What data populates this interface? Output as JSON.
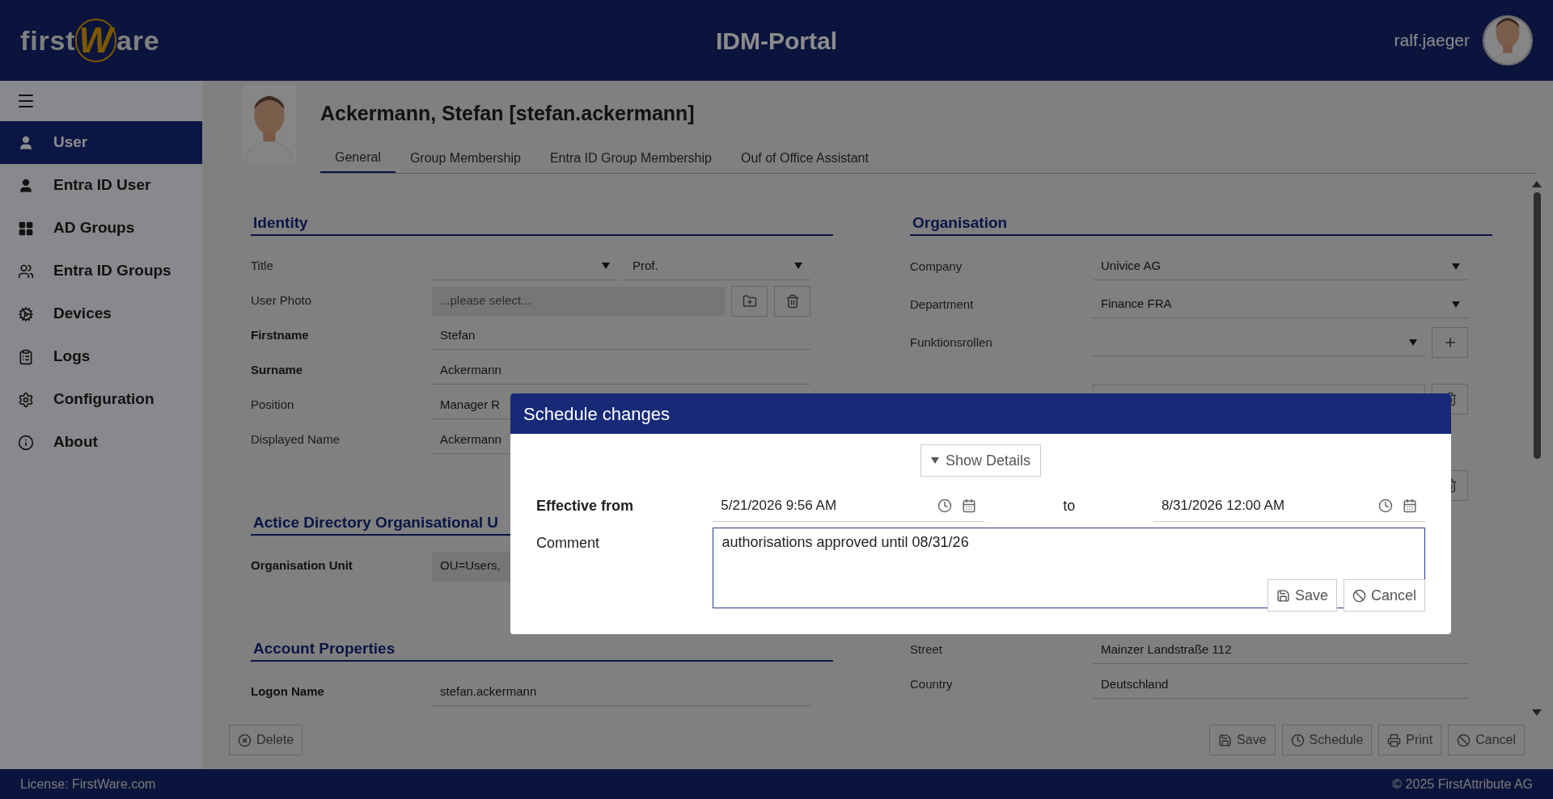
{
  "header": {
    "logo": {
      "left": "first",
      "mark": "W",
      "right": "are"
    },
    "title": "IDM-Portal",
    "username": "ralf.jaeger"
  },
  "sidebar": {
    "items": [
      {
        "label": "User",
        "kind": "user",
        "selected": true
      },
      {
        "label": "Entra ID User",
        "kind": "user",
        "selected": false
      },
      {
        "label": "AD Groups",
        "kind": "grid",
        "selected": false
      },
      {
        "label": "Entra ID Groups",
        "kind": "groups",
        "selected": false
      },
      {
        "label": "Devices",
        "kind": "cogs",
        "selected": false
      },
      {
        "label": "Logs",
        "kind": "clipboard",
        "selected": false
      },
      {
        "label": "Configuration",
        "kind": "gear",
        "selected": false
      },
      {
        "label": "About",
        "kind": "info",
        "selected": false
      }
    ]
  },
  "profile": {
    "heading": "Ackermann, Stefan [stefan.ackermann]"
  },
  "tabs": [
    {
      "label": "General",
      "selected": true
    },
    {
      "label": "Group Membership",
      "selected": false
    },
    {
      "label": "Entra ID Group Membership",
      "selected": false
    },
    {
      "label": "Ouf of Office Assistant",
      "selected": false
    }
  ],
  "left_sections": [
    {
      "title": "Identity",
      "rows": [
        {
          "label": "Title",
          "bold": false,
          "controls": [
            {
              "kind": "select"
            },
            {
              "kind": "select",
              "value": "Prof."
            }
          ]
        },
        {
          "label": "User Photo",
          "bold": false,
          "controls": [
            {
              "kind": "file",
              "placeholder": "...please select..."
            },
            {
              "kind": "browse"
            },
            {
              "kind": "delete"
            }
          ]
        },
        {
          "label": "Firstname",
          "bold": true,
          "controls": [
            {
              "kind": "text",
              "value": "Stefan"
            }
          ]
        },
        {
          "label": "Surname",
          "bold": true,
          "controls": [
            {
              "kind": "text",
              "value": "Ackermann"
            }
          ]
        },
        {
          "label": "Position",
          "bold": false,
          "controls": [
            {
              "kind": "text",
              "value": "Manager R"
            }
          ]
        },
        {
          "label": "Displayed Name",
          "bold": false,
          "controls": [
            {
              "kind": "text",
              "value": "Ackermann"
            }
          ]
        }
      ]
    },
    {
      "title": "Actice Directory Organisational U",
      "rows": [
        {
          "label": "Organisation Unit",
          "bold": true,
          "controls": [
            {
              "kind": "readonly",
              "value": "OU=Users,"
            }
          ]
        }
      ]
    },
    {
      "title": "Account Properties",
      "rows": [
        {
          "label": "Logon Name",
          "bold": true,
          "controls": [
            {
              "kind": "text",
              "value": "stefan.ackermann"
            }
          ]
        }
      ]
    }
  ],
  "organisation": {
    "title": "Organisation",
    "rows": [
      {
        "label": "Company",
        "bold": false,
        "controls": [
          {
            "kind": "select",
            "value": "Univice AG"
          }
        ]
      },
      {
        "label": "Department",
        "bold": false,
        "controls": [
          {
            "kind": "select",
            "value": "Finance FRA"
          }
        ]
      },
      {
        "label": "Funktionsrollen",
        "bold": false,
        "controls": [
          {
            "kind": "select"
          },
          {
            "kind": "add"
          }
        ]
      },
      {
        "controls": [
          {
            "kind": "text-box"
          },
          {
            "kind": "delete"
          }
        ]
      },
      {
        "controls": [
          {
            "kind": "gap"
          },
          {
            "kind": "delete"
          }
        ]
      }
    ]
  },
  "address_rows": [
    {
      "label": "Street",
      "bold": false,
      "controls": [
        {
          "kind": "text",
          "value": "Mainzer Landstraße 112"
        }
      ]
    },
    {
      "label": "Country",
      "bold": false,
      "controls": [
        {
          "kind": "text",
          "value": "Deutschland"
        }
      ]
    }
  ],
  "actions": {
    "left": [
      {
        "label": "Delete",
        "kind": "delete"
      }
    ],
    "right": [
      {
        "label": "Save",
        "kind": "save"
      },
      {
        "label": "Schedule",
        "kind": "schedule"
      },
      {
        "label": "Print",
        "kind": "print"
      },
      {
        "label": "Cancel",
        "kind": "cancel"
      }
    ]
  },
  "footer": {
    "license": "License: FirstWare.com",
    "copyright": "© 2025 FirstAttribute AG"
  },
  "dialog": {
    "title": "Schedule changes",
    "details_button": "Show Details",
    "from_label": "Effective from",
    "from_value": "5/21/2026 9:56 AM",
    "to_label": "to",
    "to_value": "8/31/2026 12:00 AM",
    "comment_label": "Comment",
    "comment_value": "authorisations approved until 08/31/26",
    "buttons": [
      {
        "label": "Save",
        "kind": "save"
      },
      {
        "label": "Cancel",
        "kind": "cancel"
      }
    ]
  }
}
